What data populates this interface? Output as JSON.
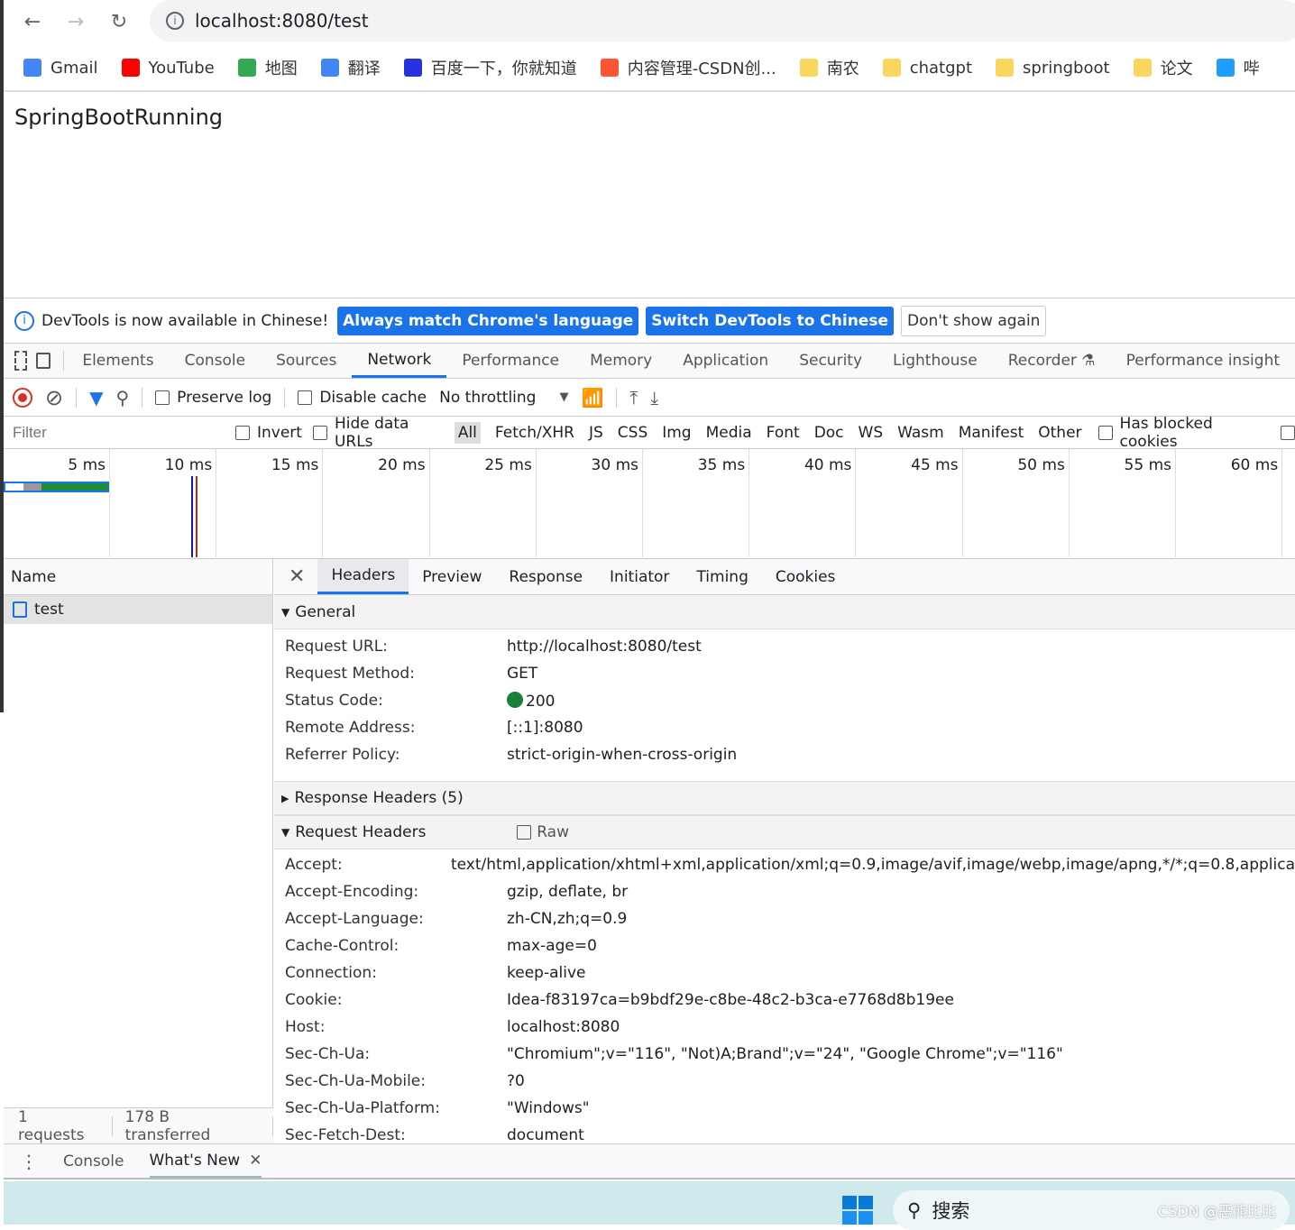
{
  "browser": {
    "url": "localhost:8080/test",
    "bookmarks": [
      {
        "label": "Gmail",
        "color": "#4285f4"
      },
      {
        "label": "YouTube",
        "color": "#ff0000"
      },
      {
        "label": "地图",
        "color": "#34a853"
      },
      {
        "label": "翻译",
        "color": "#4285f4"
      },
      {
        "label": "百度一下，你就知道",
        "color": "#2932e1"
      },
      {
        "label": "内容管理-CSDN创...",
        "color": "#fc5531"
      },
      {
        "label": "南农",
        "color": "#f9d65c"
      },
      {
        "label": "chatgpt",
        "color": "#f9d65c"
      },
      {
        "label": "springboot",
        "color": "#f9d65c"
      },
      {
        "label": "论文",
        "color": "#f9d65c"
      },
      {
        "label": "哔",
        "color": "#1e9fff"
      }
    ]
  },
  "page": {
    "text": "SpringBootRunning"
  },
  "infobar": {
    "message": "DevTools is now available in Chinese!",
    "btn1": "Always match Chrome's language",
    "btn2": "Switch DevTools to Chinese",
    "btn3": "Don't show again"
  },
  "tabs": [
    "Elements",
    "Console",
    "Sources",
    "Network",
    "Performance",
    "Memory",
    "Application",
    "Security",
    "Lighthouse",
    "Recorder ⚗",
    "Performance insight"
  ],
  "active_tab": "Network",
  "toolbar": {
    "preserve_log": "Preserve log",
    "disable_cache": "Disable cache",
    "throttling": "No throttling"
  },
  "filterbar": {
    "placeholder": "Filter",
    "invert": "Invert",
    "hide_data": "Hide data URLs",
    "types": [
      "All",
      "Fetch/XHR",
      "JS",
      "CSS",
      "Img",
      "Media",
      "Font",
      "Doc",
      "WS",
      "Wasm",
      "Manifest",
      "Other"
    ],
    "blocked": "Has blocked cookies"
  },
  "timeline": [
    "5 ms",
    "10 ms",
    "15 ms",
    "20 ms",
    "25 ms",
    "30 ms",
    "35 ms",
    "40 ms",
    "45 ms",
    "50 ms",
    "55 ms",
    "60 ms"
  ],
  "requests": {
    "header": "Name",
    "items": [
      "test"
    ],
    "status": [
      "1 requests",
      "178 B transferred"
    ]
  },
  "detail_tabs": [
    "Headers",
    "Preview",
    "Response",
    "Initiator",
    "Timing",
    "Cookies"
  ],
  "general": {
    "title": "General",
    "rows": [
      [
        "Request URL:",
        "http://localhost:8080/test"
      ],
      [
        "Request Method:",
        "GET"
      ],
      [
        "Status Code:",
        "200"
      ],
      [
        "Remote Address:",
        "[::1]:8080"
      ],
      [
        "Referrer Policy:",
        "strict-origin-when-cross-origin"
      ]
    ],
    "status_color": "#188038"
  },
  "response_headers": "Response Headers (5)",
  "request_headers": {
    "title": "Request Headers",
    "raw": "Raw",
    "rows": [
      [
        "Accept:",
        "text/html,application/xhtml+xml,application/xml;q=0.9,image/avif,image/webp,image/apng,*/*;q=0.8,applica"
      ],
      [
        "Accept-Encoding:",
        "gzip, deflate, br"
      ],
      [
        "Accept-Language:",
        "zh-CN,zh;q=0.9"
      ],
      [
        "Cache-Control:",
        "max-age=0"
      ],
      [
        "Connection:",
        "keep-alive"
      ],
      [
        "Cookie:",
        "Idea-f83197ca=b9bdf29e-c8be-48c2-b3ca-e7768d8b19ee"
      ],
      [
        "Host:",
        "localhost:8080"
      ],
      [
        "Sec-Ch-Ua:",
        "\"Chromium\";v=\"116\", \"Not)A;Brand\";v=\"24\", \"Google Chrome\";v=\"116\""
      ],
      [
        "Sec-Ch-Ua-Mobile:",
        "?0"
      ],
      [
        "Sec-Ch-Ua-Platform:",
        "\"Windows\""
      ],
      [
        "Sec-Fetch-Dest:",
        "document"
      ]
    ]
  },
  "drawer": {
    "tabs": [
      "Console",
      "What's New"
    ]
  },
  "taskbar": {
    "search": "搜索",
    "watermark": "CSDN @恶熊比比"
  }
}
